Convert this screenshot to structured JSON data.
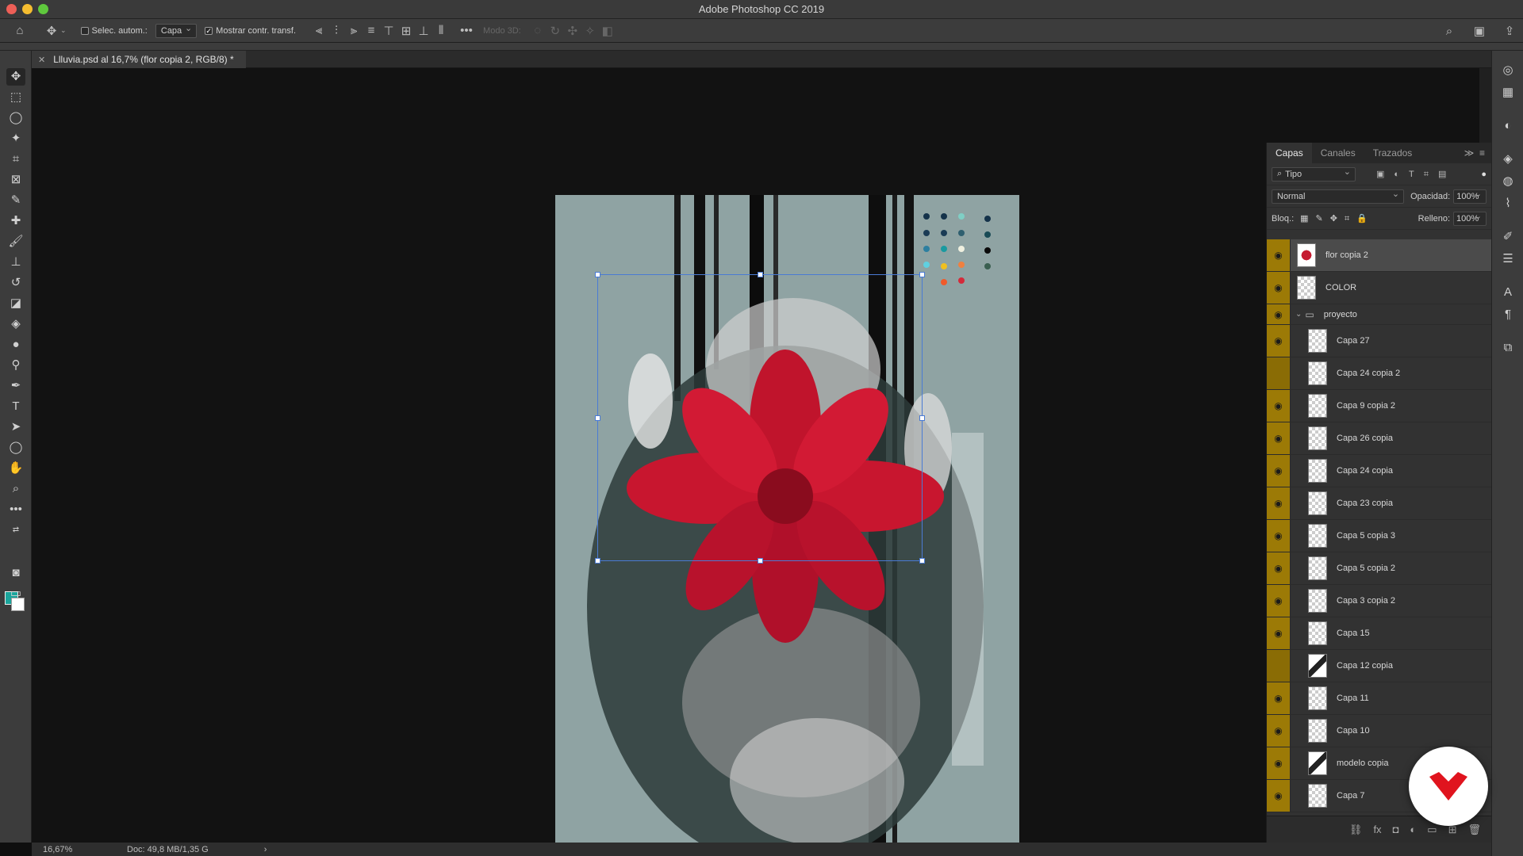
{
  "window": {
    "title": "Adobe Photoshop CC 2019"
  },
  "options_bar": {
    "auto_select_label": "Selec. autom.:",
    "auto_select_value": "Capa",
    "show_transform_label": "Mostrar contr. transf.",
    "mode_3d_label": "Modo 3D:"
  },
  "document": {
    "tab_title": "Llluvia.psd al 16,7% (flor copia 2, RGB/8) *"
  },
  "status_bar": {
    "zoom": "16,67%",
    "doc_size": "Doc: 49,8 MB/1,35 G"
  },
  "colors": {
    "foreground": "#1aa59c",
    "background": "#ffffff",
    "layer_visibility_accent": "#9c7a06"
  },
  "layers_panel": {
    "tabs": [
      {
        "label": "Capas",
        "active": true
      },
      {
        "label": "Canales",
        "active": false
      },
      {
        "label": "Trazados",
        "active": false
      }
    ],
    "filter_value": "Tipo",
    "blend_mode": "Normal",
    "opacity_label": "Opacidad:",
    "opacity_value": "100%",
    "lock_label": "Bloq.:",
    "fill_label": "Relleno:",
    "fill_value": "100%",
    "layers": [
      {
        "name": "flor copia 2",
        "visible": true,
        "selected": true,
        "type": "layer",
        "thumb": "flower",
        "indented": false
      },
      {
        "name": "COLOR",
        "visible": true,
        "selected": false,
        "type": "layer",
        "thumb": "blank",
        "indented": false
      },
      {
        "name": "proyecto",
        "visible": true,
        "selected": false,
        "type": "group",
        "thumb": "folder",
        "indented": false
      },
      {
        "name": "Capa 27",
        "visible": true,
        "selected": false,
        "type": "layer",
        "thumb": "blank",
        "indented": true
      },
      {
        "name": "Capa 24 copia 2",
        "visible": false,
        "selected": false,
        "type": "layer",
        "thumb": "blank",
        "indented": true
      },
      {
        "name": "Capa 9 copia 2",
        "visible": true,
        "selected": false,
        "type": "layer",
        "thumb": "blank",
        "indented": true
      },
      {
        "name": "Capa 26 copia",
        "visible": true,
        "selected": false,
        "type": "layer",
        "thumb": "blank",
        "indented": true
      },
      {
        "name": "Capa 24 copia",
        "visible": true,
        "selected": false,
        "type": "layer",
        "thumb": "blank",
        "indented": true
      },
      {
        "name": "Capa 23 copia",
        "visible": true,
        "selected": false,
        "type": "layer",
        "thumb": "blank",
        "indented": true
      },
      {
        "name": "Capa 5 copia 3",
        "visible": true,
        "selected": false,
        "type": "layer",
        "thumb": "blank",
        "indented": true
      },
      {
        "name": "Capa 5 copia 2",
        "visible": true,
        "selected": false,
        "type": "layer",
        "thumb": "blank",
        "indented": true
      },
      {
        "name": "Capa 3 copia 2",
        "visible": true,
        "selected": false,
        "type": "layer",
        "thumb": "blank",
        "indented": true
      },
      {
        "name": "Capa 15",
        "visible": true,
        "selected": false,
        "type": "layer",
        "thumb": "blank",
        "indented": true
      },
      {
        "name": "Capa 12 copia",
        "visible": false,
        "selected": false,
        "type": "layer",
        "thumb": "dark",
        "indented": true
      },
      {
        "name": "Capa 11",
        "visible": true,
        "selected": false,
        "type": "layer",
        "thumb": "blank",
        "indented": true
      },
      {
        "name": "Capa 10",
        "visible": true,
        "selected": false,
        "type": "layer",
        "thumb": "blank",
        "indented": true
      },
      {
        "name": "modelo copia",
        "visible": true,
        "selected": false,
        "type": "layer",
        "thumb": "dark",
        "indented": true
      },
      {
        "name": "Capa 7",
        "visible": true,
        "selected": false,
        "type": "layer",
        "thumb": "blank",
        "indented": true
      }
    ]
  }
}
